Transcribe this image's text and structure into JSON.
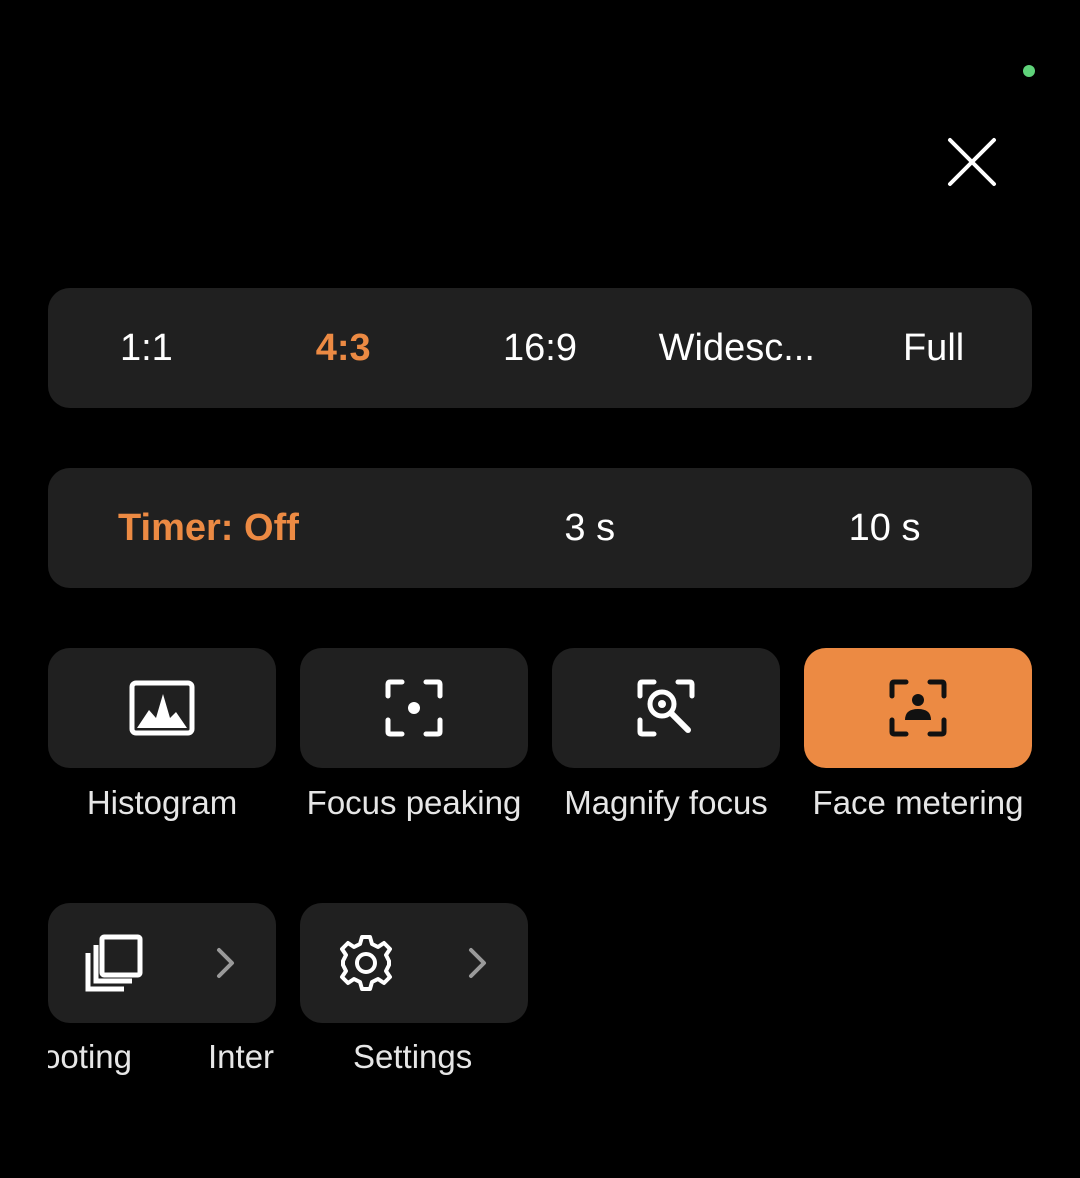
{
  "close": {
    "icon": "close-icon"
  },
  "aspect_ratio": {
    "options": [
      "1:1",
      "4:3",
      "16:9",
      "Widesc...",
      "Full"
    ],
    "selected": "4:3"
  },
  "timer": {
    "options": [
      "Timer: Off",
      "3 s",
      "10 s"
    ],
    "selected": "Timer: Off"
  },
  "tools": [
    {
      "label": "Histogram",
      "icon": "histogram-icon",
      "active": false
    },
    {
      "label": "Focus peaking",
      "icon": "focus-peaking-icon",
      "active": false
    },
    {
      "label": "Magnify focus",
      "icon": "magnify-focus-icon",
      "active": false
    },
    {
      "label": "Face metering",
      "icon": "face-metering-icon",
      "active": true
    }
  ],
  "nav": [
    {
      "label_visible_left": "ooting",
      "label_visible_right": "Inter",
      "icon": "burst-stack-icon"
    },
    {
      "label": "Settings",
      "icon": "gear-icon"
    }
  ],
  "colors": {
    "accent": "#ec8a43",
    "panel": "#202020",
    "background": "#000000",
    "status_dot": "#5fd37a"
  }
}
